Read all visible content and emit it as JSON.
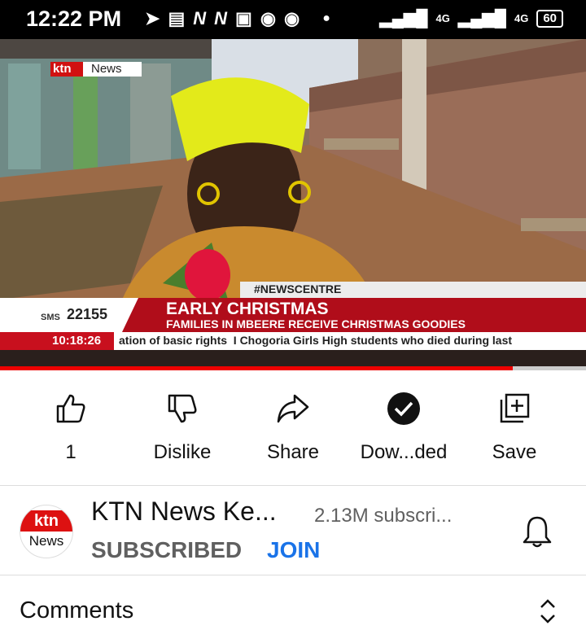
{
  "status_bar": {
    "time": "12:22 PM",
    "notif_icons": [
      "telegram-icon",
      "news-icon",
      "n-icon",
      "n-icon",
      "image-icon",
      "chrome-icon",
      "chrome-icon",
      "dot-icon"
    ],
    "net1": "4G",
    "net2": "4G",
    "battery": "60"
  },
  "video": {
    "logo_ktn": "ktn",
    "logo_news": "News",
    "hashtag": "#NEWSCENTRE",
    "sms_label": "SMS",
    "sms_number": "22155",
    "headline": "EARLY CHRISTMAS",
    "subheadline": "FAMILIES IN MBEERE RECEIVE CHRISTMAS GOODIES",
    "clock": "10:18:26",
    "ticker": "ation of basic rights  I Chogoria Girls High students who died during last",
    "progress_fraction": 0.875
  },
  "actions": {
    "like_count": "1",
    "dislike": "Dislike",
    "share": "Share",
    "download": "Dow...ded",
    "save": "Save"
  },
  "channel": {
    "avatar_top": "ktn",
    "avatar_bottom": "News",
    "name": "KTN News Ke...",
    "subscribers": "2.13M subscri...",
    "subscribed": "SUBSCRIBED",
    "join": "JOIN"
  },
  "comments": {
    "label": "Comments"
  },
  "colors": {
    "accent_red": "#e00000",
    "join_blue": "#1a73e8",
    "ktn_red": "#d11111"
  }
}
